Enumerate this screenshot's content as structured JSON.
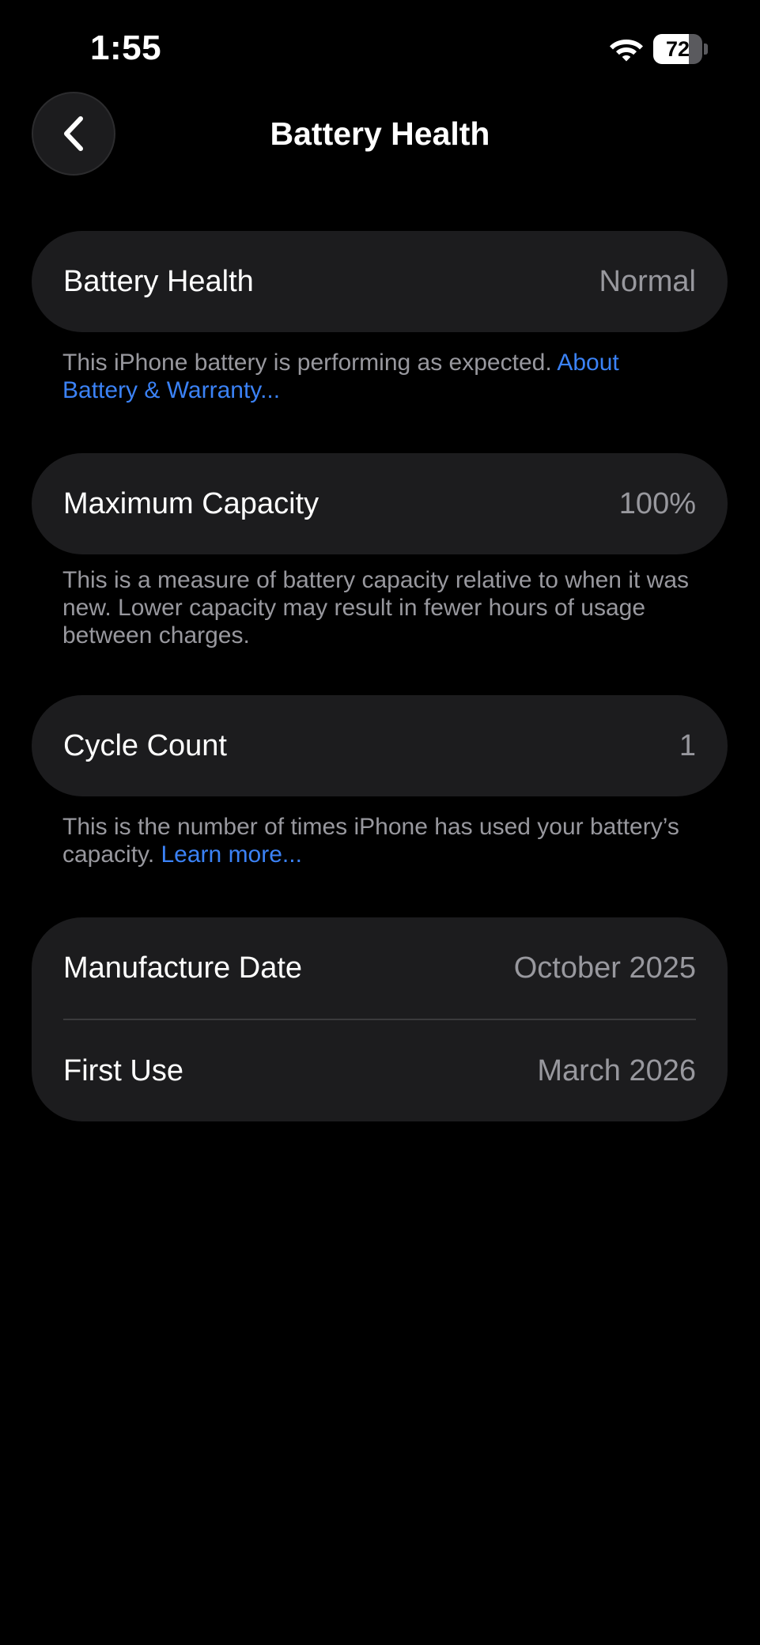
{
  "status_bar": {
    "time": "1:55",
    "battery_percent": "72",
    "battery_level": 0.72
  },
  "nav": {
    "back_icon": "chevron-left-icon",
    "title": "Battery Health"
  },
  "sections": {
    "health": {
      "label": "Battery Health",
      "value": "Normal",
      "footer_text": "This iPhone battery is performing as expected. ",
      "footer_link": "About Battery & Warranty..."
    },
    "capacity": {
      "label": "Maximum Capacity",
      "value": "100%",
      "footer_text": "This is a measure of battery capacity relative to when it was new. Lower capacity may result in fewer hours of usage between charges."
    },
    "cycles": {
      "label": "Cycle Count",
      "value": "1",
      "footer_text": "This is the number of times iPhone has used your battery’s capacity. ",
      "footer_link": "Learn more..."
    },
    "dates": {
      "manufacture_label": "Manufacture Date",
      "manufacture_value": "October 2025",
      "first_use_label": "First Use",
      "first_use_value": "March 2026"
    }
  },
  "colors": {
    "background": "#000000",
    "card": "#1c1c1e",
    "secondary_text": "#98989e",
    "link": "#3b82f6"
  }
}
